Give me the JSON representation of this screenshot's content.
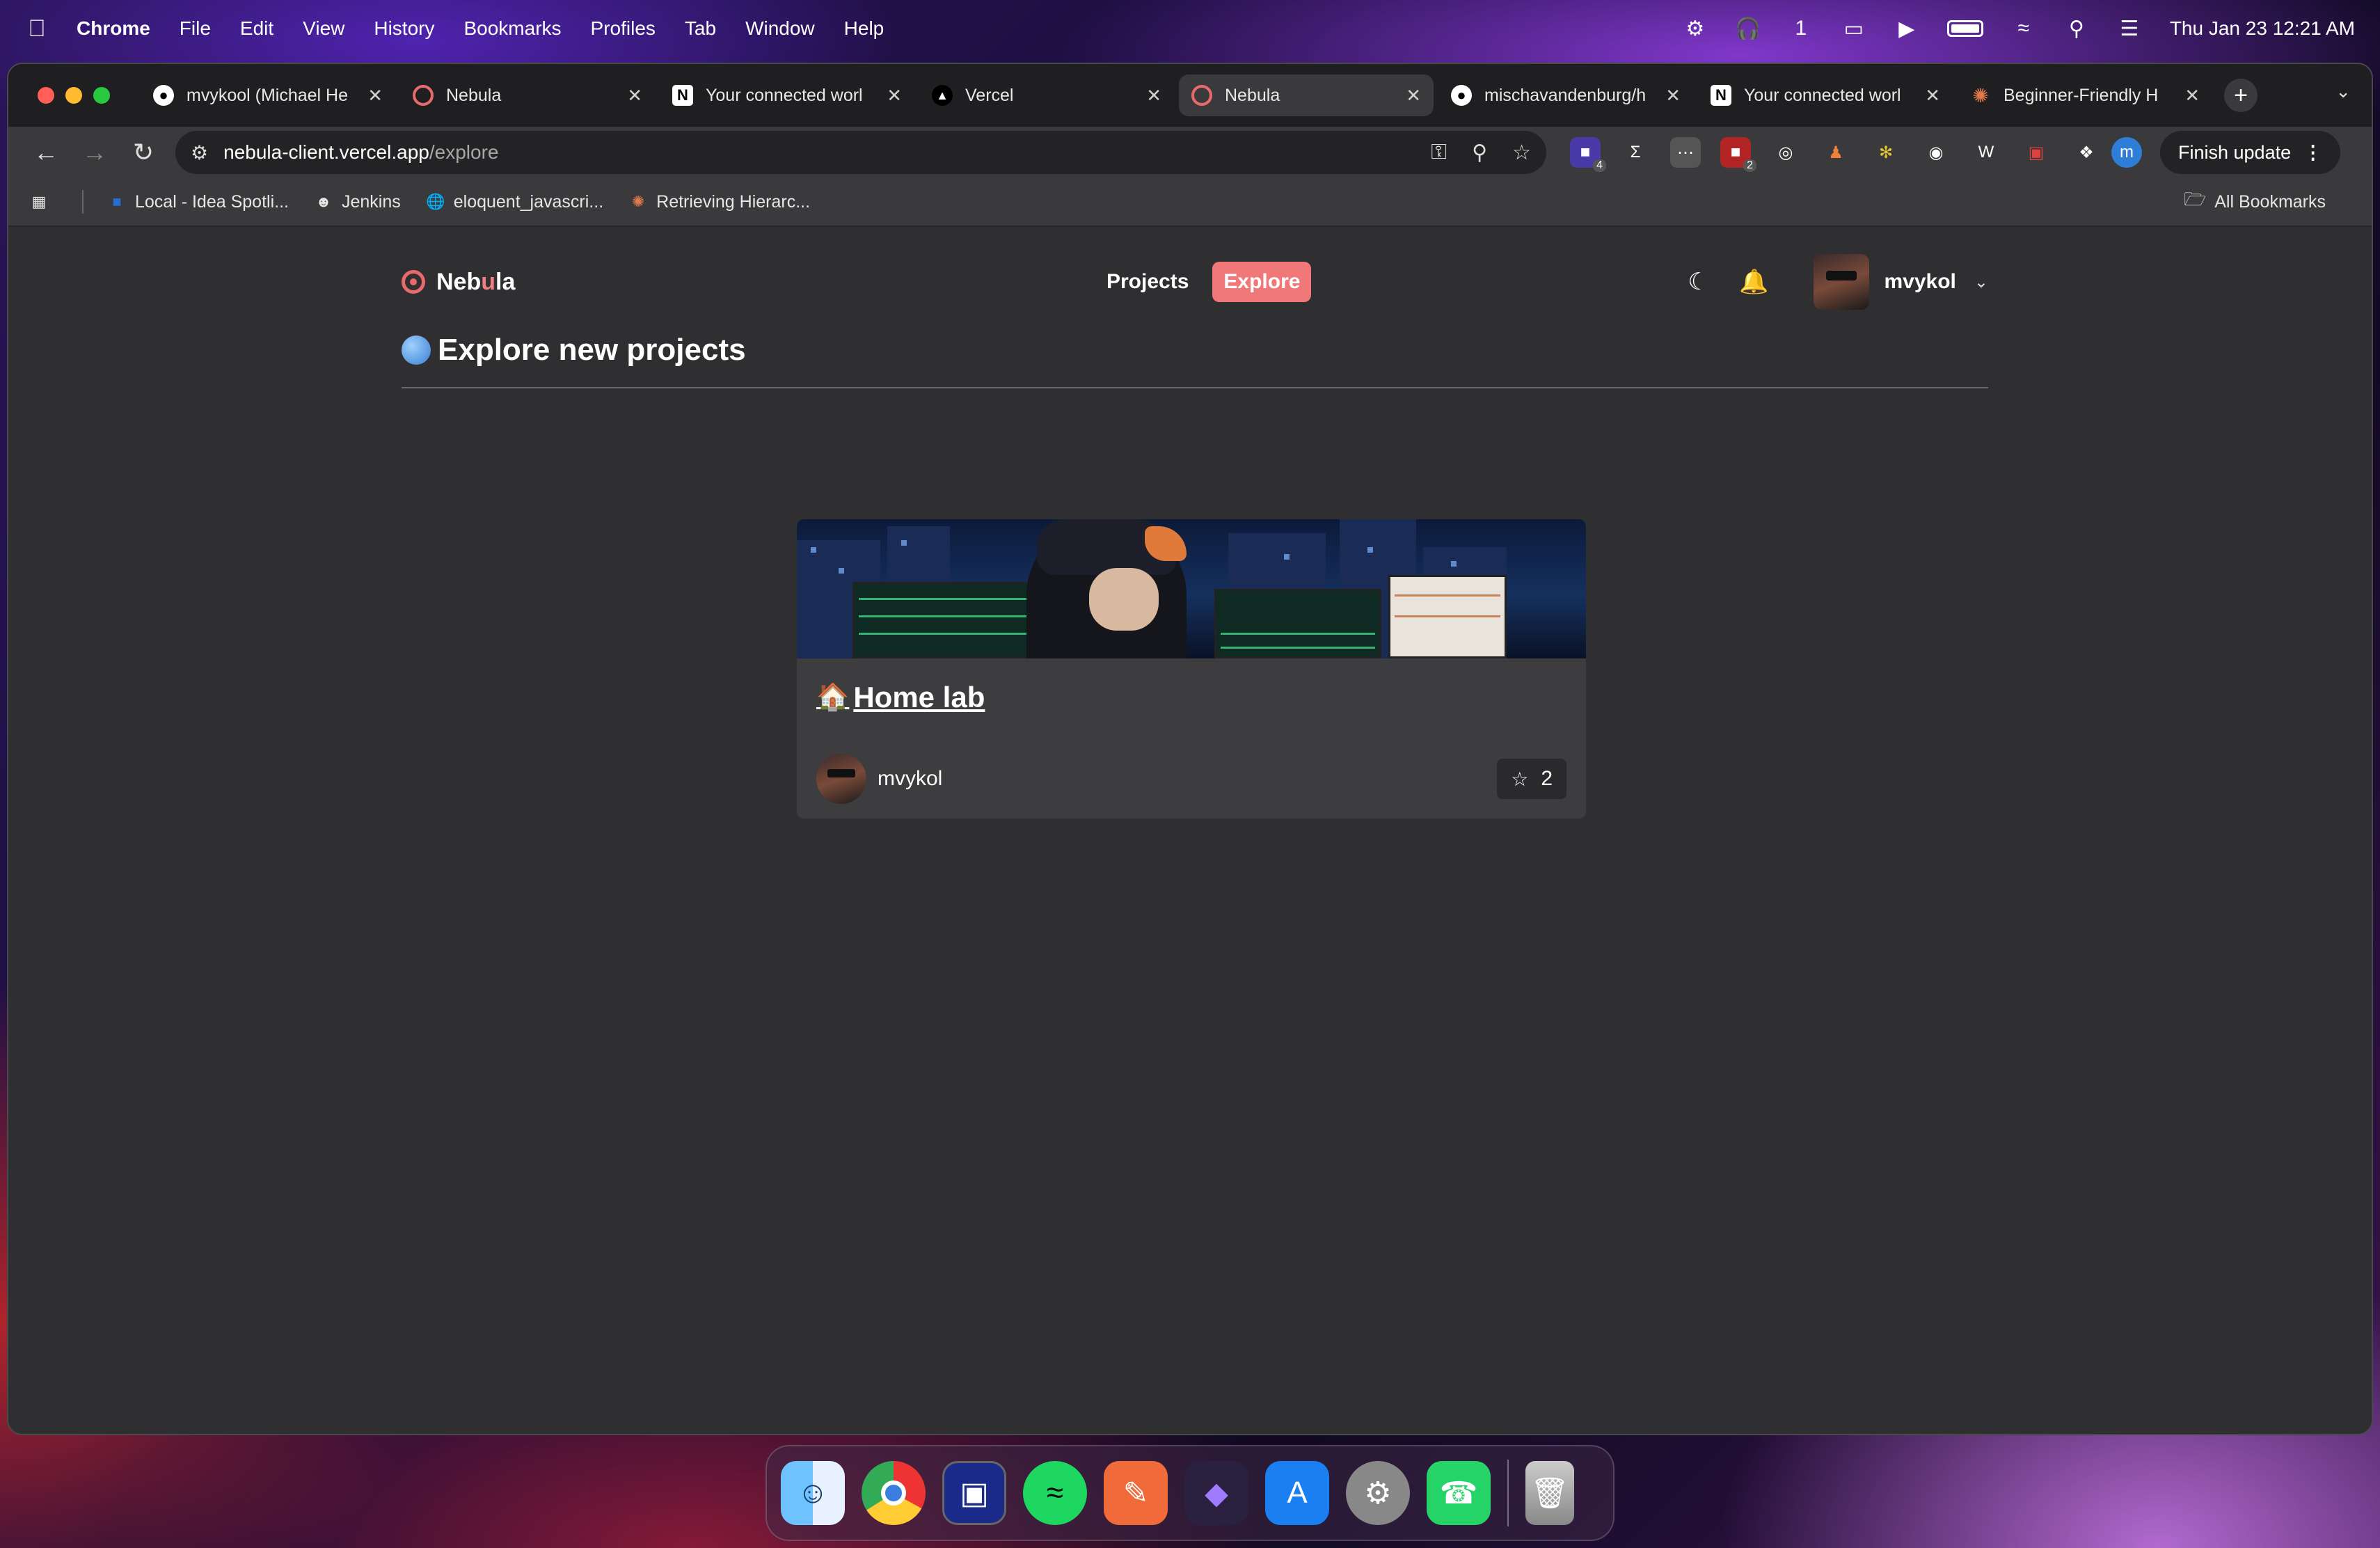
{
  "menubar": {
    "app": "Chrome",
    "items": [
      "File",
      "Edit",
      "View",
      "History",
      "Bookmarks",
      "Profiles",
      "Tab",
      "Window",
      "Help"
    ],
    "status_count": "1",
    "datetime": "Thu Jan 23  12:21 AM"
  },
  "tabs": [
    {
      "title": "mvykool (Michael He",
      "favicon": "github-icon"
    },
    {
      "title": "Nebula",
      "favicon": "nebula-icon"
    },
    {
      "title": "Your connected worl",
      "favicon": "notion-icon"
    },
    {
      "title": "Vercel",
      "favicon": "vercel-icon"
    },
    {
      "title": "Nebula",
      "favicon": "nebula-icon",
      "active": true
    },
    {
      "title": "mischavandenburg/h",
      "favicon": "github-icon"
    },
    {
      "title": "Your connected worl",
      "favicon": "notion-icon"
    },
    {
      "title": "Beginner-Friendly H",
      "favicon": "claude-icon"
    }
  ],
  "address": {
    "host": "nebula-client.vercel.app",
    "path": "/explore"
  },
  "extensions": {
    "badge_1": "4",
    "badge_2": "2",
    "profile_letter": "m",
    "finish_update": "Finish update"
  },
  "bookmarks": {
    "items": [
      "Local - Idea Spotli...",
      "Jenkins",
      "eloquent_javascri...",
      "Retrieving Hierarc..."
    ],
    "all": "All Bookmarks"
  },
  "app": {
    "brand_pre": "Neb",
    "brand_u": "u",
    "brand_post": "la",
    "nav": {
      "projects": "Projects",
      "explore": "Explore"
    },
    "username": "mvykol"
  },
  "page": {
    "title": "Explore new projects"
  },
  "project": {
    "title": "Home lab",
    "owner": "mvykol",
    "stars": "2"
  },
  "colors": {
    "accent": "#f07878",
    "page_bg": "#2f2f31",
    "card_bg": "#3d3d40"
  }
}
